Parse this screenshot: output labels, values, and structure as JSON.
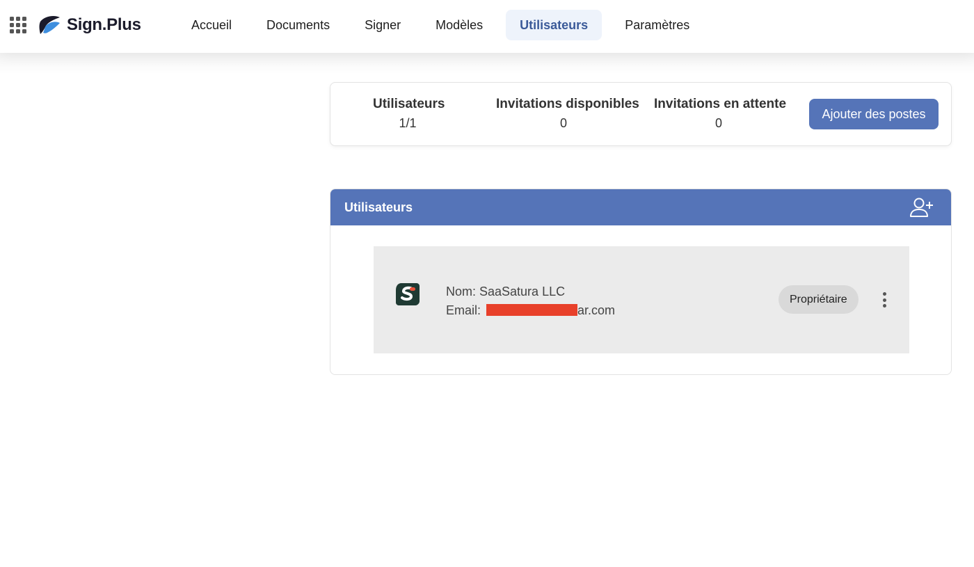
{
  "brand": {
    "name": "Sign.Plus"
  },
  "nav": {
    "items": [
      {
        "label": "Accueil"
      },
      {
        "label": "Documents"
      },
      {
        "label": "Signer"
      },
      {
        "label": "Modèles"
      },
      {
        "label": "Utilisateurs",
        "active": true
      },
      {
        "label": "Paramètres"
      }
    ]
  },
  "stats": {
    "users": {
      "label": "Utilisateurs",
      "value": "1/1"
    },
    "available": {
      "label": "Invitations disponibles",
      "value": "0"
    },
    "pending": {
      "label": "Invitations en attente",
      "value": "0"
    },
    "add_button": "Ajouter des postes"
  },
  "panel": {
    "title": "Utilisateurs",
    "users": [
      {
        "name_line": "Nom: SaaSatura LLC",
        "email_prefix": "Email: ",
        "email_suffix": "ar.com",
        "role": "Propriétaire"
      }
    ]
  },
  "colors": {
    "accent": "#5574b8",
    "active_nav_bg": "#eef3fb",
    "active_nav_text": "#3b5a99",
    "row_bg": "#ebebeb",
    "redaction": "#e8402a"
  },
  "icons": {
    "apps": "grid-apps-icon",
    "add_user": "add-user-icon",
    "more": "more-vertical-icon",
    "avatar": "saasatura-logo-icon"
  }
}
